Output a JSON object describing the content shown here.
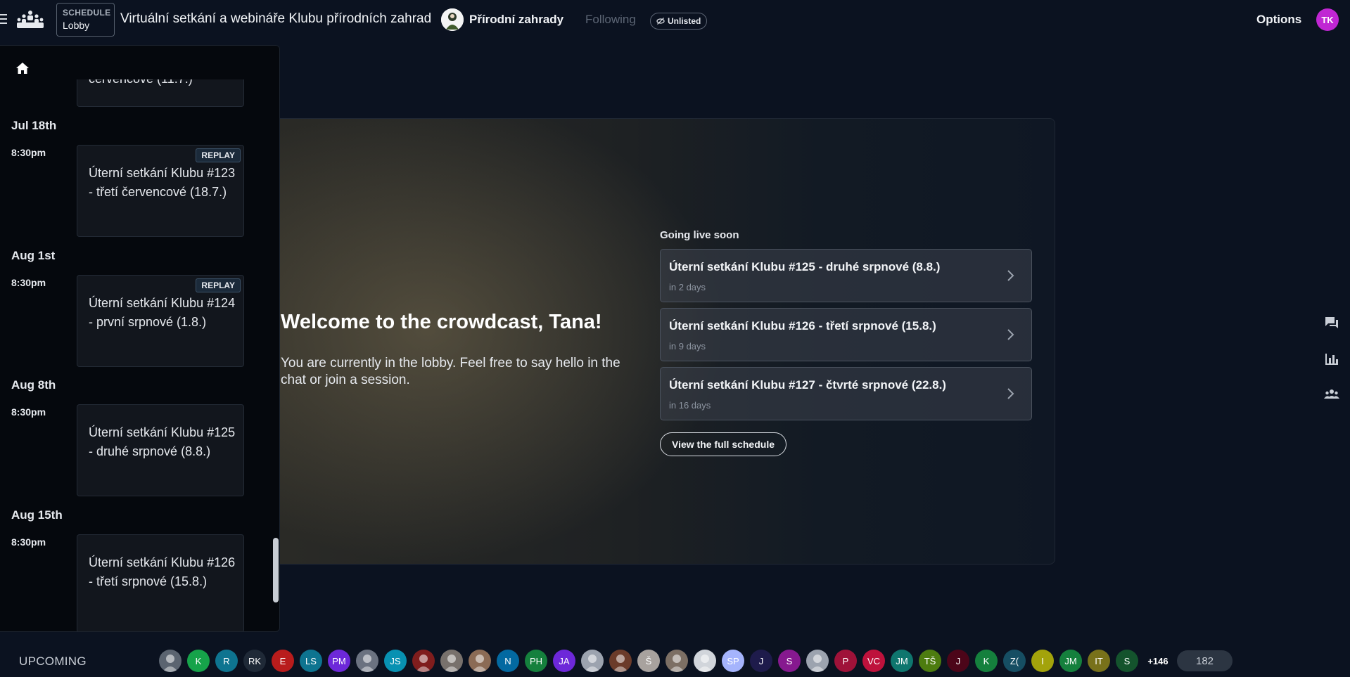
{
  "header": {
    "schedule_small": "SCHEDULE",
    "schedule_big": "Lobby",
    "event_title": "Virtuální setkání a webináře Klubu přírodních zahrad",
    "org_name": "Přírodní zahrady",
    "following_label": "Following",
    "unlisted_label": "Unlisted",
    "options_label": "Options",
    "user_initials": "TK",
    "user_avatar_color": "#c026d3"
  },
  "schedule": {
    "partial_card_text": "červencové (11.7.)",
    "days": [
      {
        "date": "Jul 18th",
        "time": "8:30pm",
        "title": "Úterní setkání Klubu #123 - třetí červencové (18.7.)",
        "badge": "REPLAY"
      },
      {
        "date": "Aug 1st",
        "time": "8:30pm",
        "title": "Úterní setkání Klubu #124 - první srpnové (1.8.)",
        "badge": "REPLAY"
      },
      {
        "date": "Aug 8th",
        "time": "8:30pm",
        "title": "Úterní setkání Klubu #125 - druhé srpnové (8.8.)",
        "badge": ""
      },
      {
        "date": "Aug 15th",
        "time": "8:30pm",
        "title": "Úterní setkání Klubu #126 - třetí srpnové (15.8.)",
        "badge": ""
      }
    ]
  },
  "lobby": {
    "welcome": "Welcome to the crowdcast, Tana!",
    "message": "You are currently in the lobby. Feel free to say hello in the chat or join a session.",
    "going_live_label": "Going live soon",
    "upcoming": [
      {
        "title": "Úterní setkání Klubu #125 - druhé srpnové (8.8.)",
        "when": "in 2 days"
      },
      {
        "title": "Úterní setkání Klubu #126 - třetí srpnové (15.8.)",
        "when": "in 9 days"
      },
      {
        "title": "Úterní setkání Klubu #127 - čtvrté srpnové (22.8.)",
        "when": "in 16 days"
      }
    ],
    "full_schedule_label": "View the full schedule"
  },
  "right_rail": {
    "icons": [
      "chat-icon",
      "poll-icon",
      "people-icon"
    ]
  },
  "bottom": {
    "upcoming_label": "UPCOMING",
    "attendees": [
      {
        "initials": "",
        "color": "#5b6470",
        "photo": true
      },
      {
        "initials": "K",
        "color": "#16a34a"
      },
      {
        "initials": "R",
        "color": "#0e7490"
      },
      {
        "initials": "RK",
        "color": "#1f2937"
      },
      {
        "initials": "E",
        "color": "#b91c1c"
      },
      {
        "initials": "LS",
        "color": "#0e7490"
      },
      {
        "initials": "PM",
        "color": "#6d28d9"
      },
      {
        "initials": "",
        "color": "#6b7280",
        "photo": true
      },
      {
        "initials": "JS",
        "color": "#0891b2"
      },
      {
        "initials": "",
        "color": "#7f1d1d",
        "photo": true
      },
      {
        "initials": "",
        "color": "#78716c",
        "photo": true
      },
      {
        "initials": "",
        "color": "#8b6b55",
        "photo": true
      },
      {
        "initials": "N",
        "color": "#0369a1"
      },
      {
        "initials": "PH",
        "color": "#15803d"
      },
      {
        "initials": "JA",
        "color": "#6d28d9"
      },
      {
        "initials": "",
        "color": "#9ca3af",
        "photo": true
      },
      {
        "initials": "",
        "color": "#6b3b2a",
        "photo": true
      },
      {
        "initials": "Š",
        "color": "#a8a29e"
      },
      {
        "initials": "",
        "color": "#7c6f64",
        "photo": true
      },
      {
        "initials": "",
        "color": "#d1d5db",
        "photo": true
      },
      {
        "initials": "SP",
        "color": "#a5b4fc"
      },
      {
        "initials": "J",
        "color": "#1e1b4b"
      },
      {
        "initials": "S",
        "color": "#86198f"
      },
      {
        "initials": "",
        "color": "#9ca3af",
        "photo": true
      },
      {
        "initials": "P",
        "color": "#9f1239"
      },
      {
        "initials": "VC",
        "color": "#be123c"
      },
      {
        "initials": "JM",
        "color": "#0f766e"
      },
      {
        "initials": "TŠ",
        "color": "#4d7c0f"
      },
      {
        "initials": "J",
        "color": "#4c0519"
      },
      {
        "initials": "K",
        "color": "#15803d"
      },
      {
        "initials": "Z(",
        "color": "#164e63"
      },
      {
        "initials": "I",
        "color": "#a3a30b"
      },
      {
        "initials": "JM",
        "color": "#15803d"
      },
      {
        "initials": "IT",
        "color": "#78711a"
      },
      {
        "initials": "S",
        "color": "#14532d"
      }
    ],
    "more_label": "+146",
    "viewer_count": "182"
  },
  "colors": {
    "background": "#0b1220",
    "panel": "#05080d",
    "accent_avatar": "#c026d3"
  }
}
